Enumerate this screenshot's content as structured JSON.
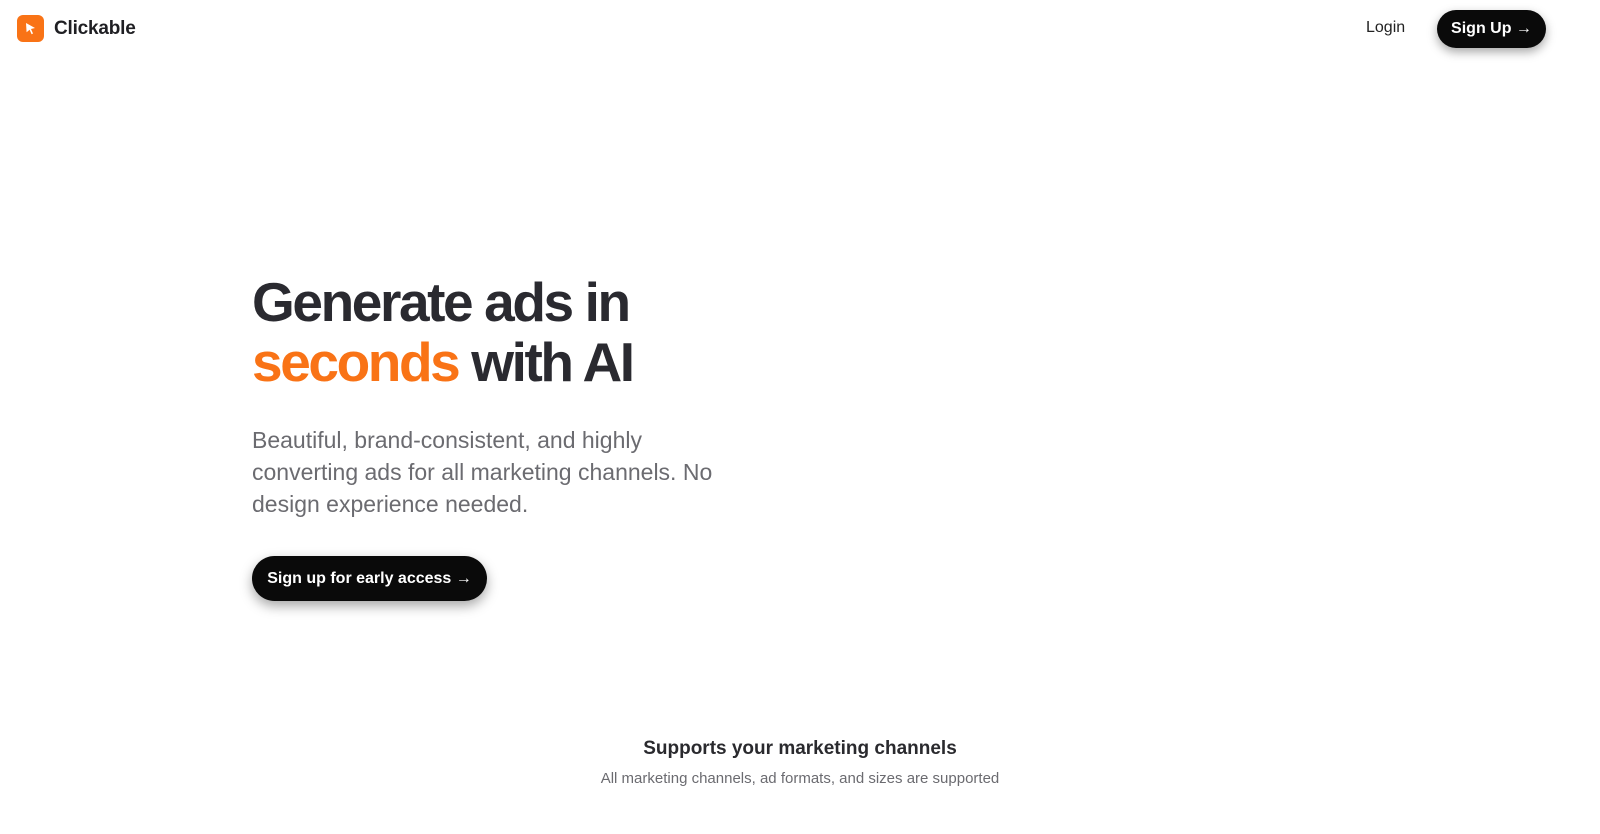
{
  "brand": {
    "name": "Clickable",
    "icon": "cursor-click-icon",
    "color": "#f97316"
  },
  "nav": {
    "login_label": "Login",
    "signup_label": "Sign Up →"
  },
  "hero": {
    "headline_line1": "Generate ads in",
    "headline_accent": "seconds",
    "headline_rest": "with AI",
    "subhead": "Beautiful, brand-consistent, and highly converting ads for all marketing channels. No design experience needed.",
    "cta_label": "Sign up for early access →"
  },
  "channels": {
    "title": "Supports your marketing channels",
    "subtitle": "All marketing channels, ad formats, and sizes are supported"
  },
  "colors": {
    "accent": "#f97316",
    "button_bg": "#0a0a0a"
  }
}
